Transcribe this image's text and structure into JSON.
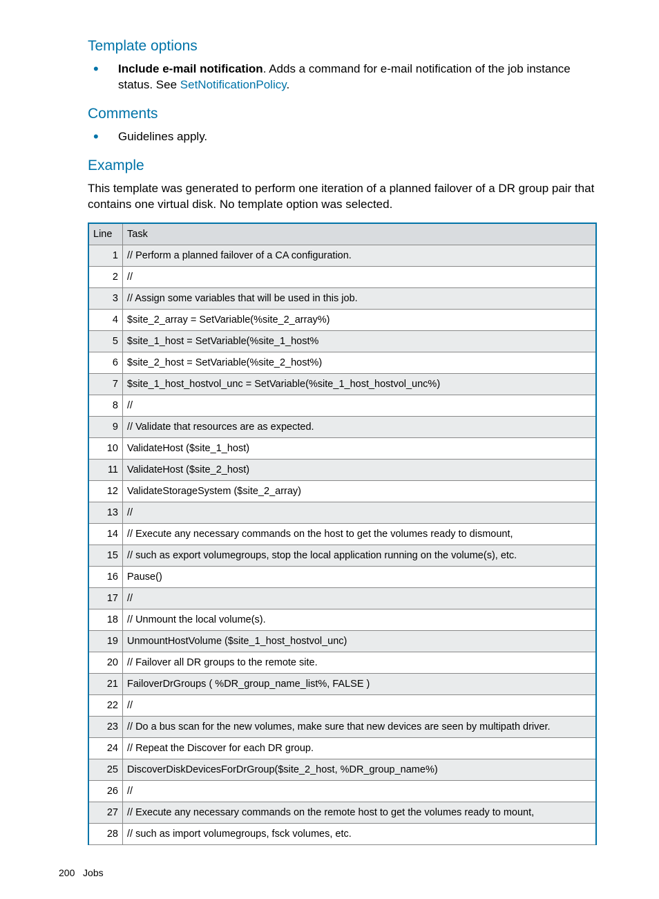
{
  "sections": {
    "template_options": {
      "heading": "Template options",
      "bullet_bold": "Include e-mail notification",
      "bullet_rest1": ".   Adds a command for e-mail notification of the job instance status. See ",
      "bullet_link": "SetNotificationPolicy",
      "bullet_rest2": "."
    },
    "comments": {
      "heading": "Comments",
      "bullet": "Guidelines apply."
    },
    "example": {
      "heading": "Example",
      "body": "This template was generated to perform one iteration of a planned failover of a DR group pair that contains one virtual disk. No template option was selected."
    }
  },
  "table": {
    "headers": {
      "line": "Line",
      "task": "Task"
    },
    "rows": [
      {
        "line": "1",
        "task": "// Perform a planned failover of a CA configuration."
      },
      {
        "line": "2",
        "task": "//"
      },
      {
        "line": "3",
        "task": "// Assign some variables that will be used in this job."
      },
      {
        "line": "4",
        "task": "$site_2_array = SetVariable(%site_2_array%)"
      },
      {
        "line": "5",
        "task": "$site_1_host = SetVariable(%site_1_host%"
      },
      {
        "line": "6",
        "task": "$site_2_host = SetVariable(%site_2_host%)"
      },
      {
        "line": "7",
        "task": "$site_1_host_hostvol_unc = SetVariable(%site_1_host_hostvol_unc%)"
      },
      {
        "line": "8",
        "task": "//"
      },
      {
        "line": "9",
        "task": "// Validate that resources are as expected."
      },
      {
        "line": "10",
        "task": "ValidateHost ($site_1_host)"
      },
      {
        "line": "11",
        "task": "ValidateHost ($site_2_host)"
      },
      {
        "line": "12",
        "task": "ValidateStorageSystem ($site_2_array)"
      },
      {
        "line": "13",
        "task": "//"
      },
      {
        "line": "14",
        "task": "// Execute any necessary commands on the host to get the volumes ready to dismount,"
      },
      {
        "line": "15",
        "task": "// such as export volumegroups, stop the local application running on the volume(s), etc."
      },
      {
        "line": "16",
        "task": "Pause()"
      },
      {
        "line": "17",
        "task": "//"
      },
      {
        "line": "18",
        "task": "// Unmount the local volume(s)."
      },
      {
        "line": "19",
        "task": "UnmountHostVolume ($site_1_host_hostvol_unc)"
      },
      {
        "line": "20",
        "task": "// Failover all DR groups to the remote site."
      },
      {
        "line": "21",
        "task": "FailoverDrGroups ( %DR_group_name_list%, FALSE )"
      },
      {
        "line": "22",
        "task": "//"
      },
      {
        "line": "23",
        "task": "// Do a bus scan for the new volumes, make sure that new devices are seen by multipath driver."
      },
      {
        "line": "24",
        "task": "// Repeat the Discover for each DR group."
      },
      {
        "line": "25",
        "task": "DiscoverDiskDevicesForDrGroup($site_2_host, %DR_group_name%)"
      },
      {
        "line": "26",
        "task": "//"
      },
      {
        "line": "27",
        "task": "// Execute any necessary commands on the remote host to get the volumes ready to mount,"
      },
      {
        "line": "28",
        "task": "// such as import volumegroups, fsck volumes, etc."
      }
    ]
  },
  "footer": {
    "page_num": "200",
    "section": "Jobs"
  }
}
